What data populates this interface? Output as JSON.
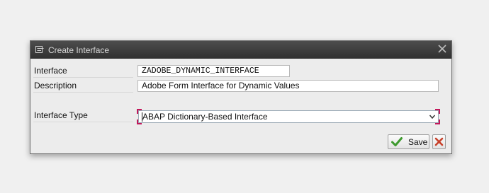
{
  "dialog": {
    "title": "Create Interface",
    "fields": {
      "interface": {
        "label": "Interface",
        "value": "ZADOBE_DYNAMIC_INTERFACE"
      },
      "description": {
        "label": "Description",
        "value": "Adobe Form Interface for Dynamic Values"
      },
      "interface_type": {
        "label": "Interface Type",
        "selected": "ABAP Dictionary-Based Interface"
      }
    },
    "buttons": {
      "save_label": "Save"
    }
  }
}
